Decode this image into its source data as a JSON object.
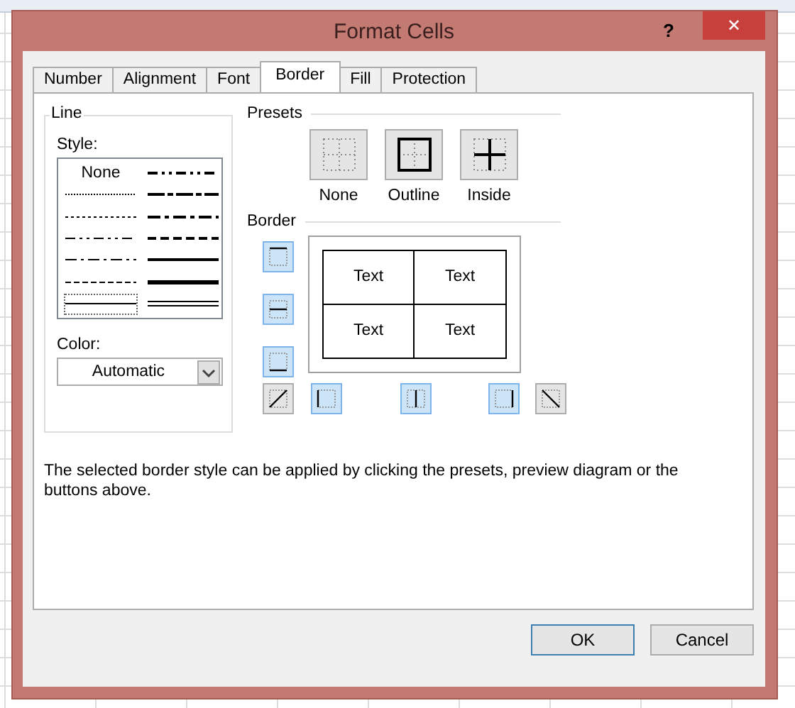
{
  "window": {
    "title": "Format Cells",
    "help": "?",
    "close": "✕"
  },
  "tabs": [
    {
      "label": "Number",
      "selected": false
    },
    {
      "label": "Alignment",
      "selected": false
    },
    {
      "label": "Font",
      "selected": false
    },
    {
      "label": "Border",
      "selected": true
    },
    {
      "label": "Fill",
      "selected": false
    },
    {
      "label": "Protection",
      "selected": false
    }
  ],
  "line": {
    "title": "Line",
    "style_label": "Style:",
    "styles": [
      {
        "kind": "none",
        "label": "None",
        "selected": false
      },
      {
        "kind": "hair",
        "selected": false
      },
      {
        "kind": "dotted",
        "selected": false
      },
      {
        "kind": "dashdotdot",
        "selected": false
      },
      {
        "kind": "dashdot",
        "selected": false
      },
      {
        "kind": "dashed",
        "selected": false
      },
      {
        "kind": "thin",
        "selected": true
      },
      {
        "kind": "medium-dashdotdot",
        "selected": false
      },
      {
        "kind": "slant-dashdot",
        "selected": false
      },
      {
        "kind": "medium-dashdot",
        "selected": false
      },
      {
        "kind": "medium-dashed",
        "selected": false
      },
      {
        "kind": "medium",
        "selected": false
      },
      {
        "kind": "thick",
        "selected": false
      },
      {
        "kind": "double",
        "selected": false
      }
    ],
    "color_label": "Color:",
    "color_value": "Automatic"
  },
  "presets": {
    "title": "Presets",
    "items": [
      {
        "kind": "none",
        "label": "None"
      },
      {
        "kind": "outline",
        "label": "Outline"
      },
      {
        "kind": "inside",
        "label": "Inside"
      }
    ]
  },
  "border": {
    "title": "Border",
    "side_toggles": [
      {
        "kind": "top",
        "on": true
      },
      {
        "kind": "hmid",
        "on": true
      },
      {
        "kind": "bottom",
        "on": true
      }
    ],
    "bottom_toggles": [
      {
        "kind": "diag-up",
        "on": false
      },
      {
        "kind": "left",
        "on": true
      },
      {
        "kind": "vmid",
        "on": true
      },
      {
        "kind": "right",
        "on": true
      },
      {
        "kind": "diag-down",
        "on": false
      }
    ],
    "preview_cells": [
      "Text",
      "Text",
      "Text",
      "Text"
    ]
  },
  "description": "The selected border style can be applied by clicking the presets, preview diagram or the buttons above.",
  "buttons": [
    "OK",
    "Cancel"
  ]
}
